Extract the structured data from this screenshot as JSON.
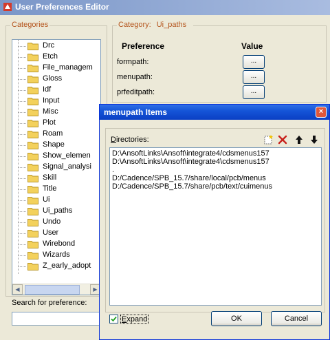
{
  "window": {
    "title": "User Preferences Editor"
  },
  "categories": {
    "label": "Categories",
    "items": [
      "Drc",
      "Etch",
      "File_managem",
      "Gloss",
      "Idf",
      "Input",
      "Misc",
      "Plot",
      "Roam",
      "Shape",
      "Show_elemen",
      "Signal_analysi",
      "Skill",
      "Title",
      "Ui",
      "Ui_paths",
      "Undo",
      "User",
      "Wirebond",
      "Wizards",
      "Z_early_adopt"
    ]
  },
  "search": {
    "label": "Search for preference:",
    "value": ""
  },
  "category_panel": {
    "category_label": "Category:",
    "category_value": "Ui_paths",
    "preference_header": "Preference",
    "value_header": "Value",
    "preferences": [
      {
        "name": "formpath:",
        "button": "..."
      },
      {
        "name": "menupath:",
        "button": "..."
      },
      {
        "name": "prfeditpath:",
        "button": "..."
      }
    ]
  },
  "dialog": {
    "title": "menupath Items",
    "close_icon": "×",
    "directories_label_prefix": "D",
    "directories_label_rest": "irectories:",
    "directories": [
      "D:\\AnsoftLinks\\Ansoft\\integrate4/cdsmenus157",
      "D:\\AnsoftLinks\\Ansoft\\integrate4\\cdsmenus157",
      ".",
      "D:/Cadence/SPB_15.7/share/local/pcb/menus",
      "D:/Cadence/SPB_15.7/share/pcb/text/cuimenus"
    ],
    "expand_prefix": "E",
    "expand_rest": "xpand",
    "expand_checked": true,
    "ok_label": "OK",
    "cancel_label": "Cancel"
  },
  "colors": {
    "group_label": "#b4541c",
    "dialog_titlebar": "#0a3fc4",
    "folder": "#f3d15c"
  },
  "icons": [
    "app-icon",
    "folder-icon",
    "new-item-icon",
    "delete-icon",
    "move-up-icon",
    "move-down-icon",
    "close-icon",
    "checkmark-icon"
  ]
}
